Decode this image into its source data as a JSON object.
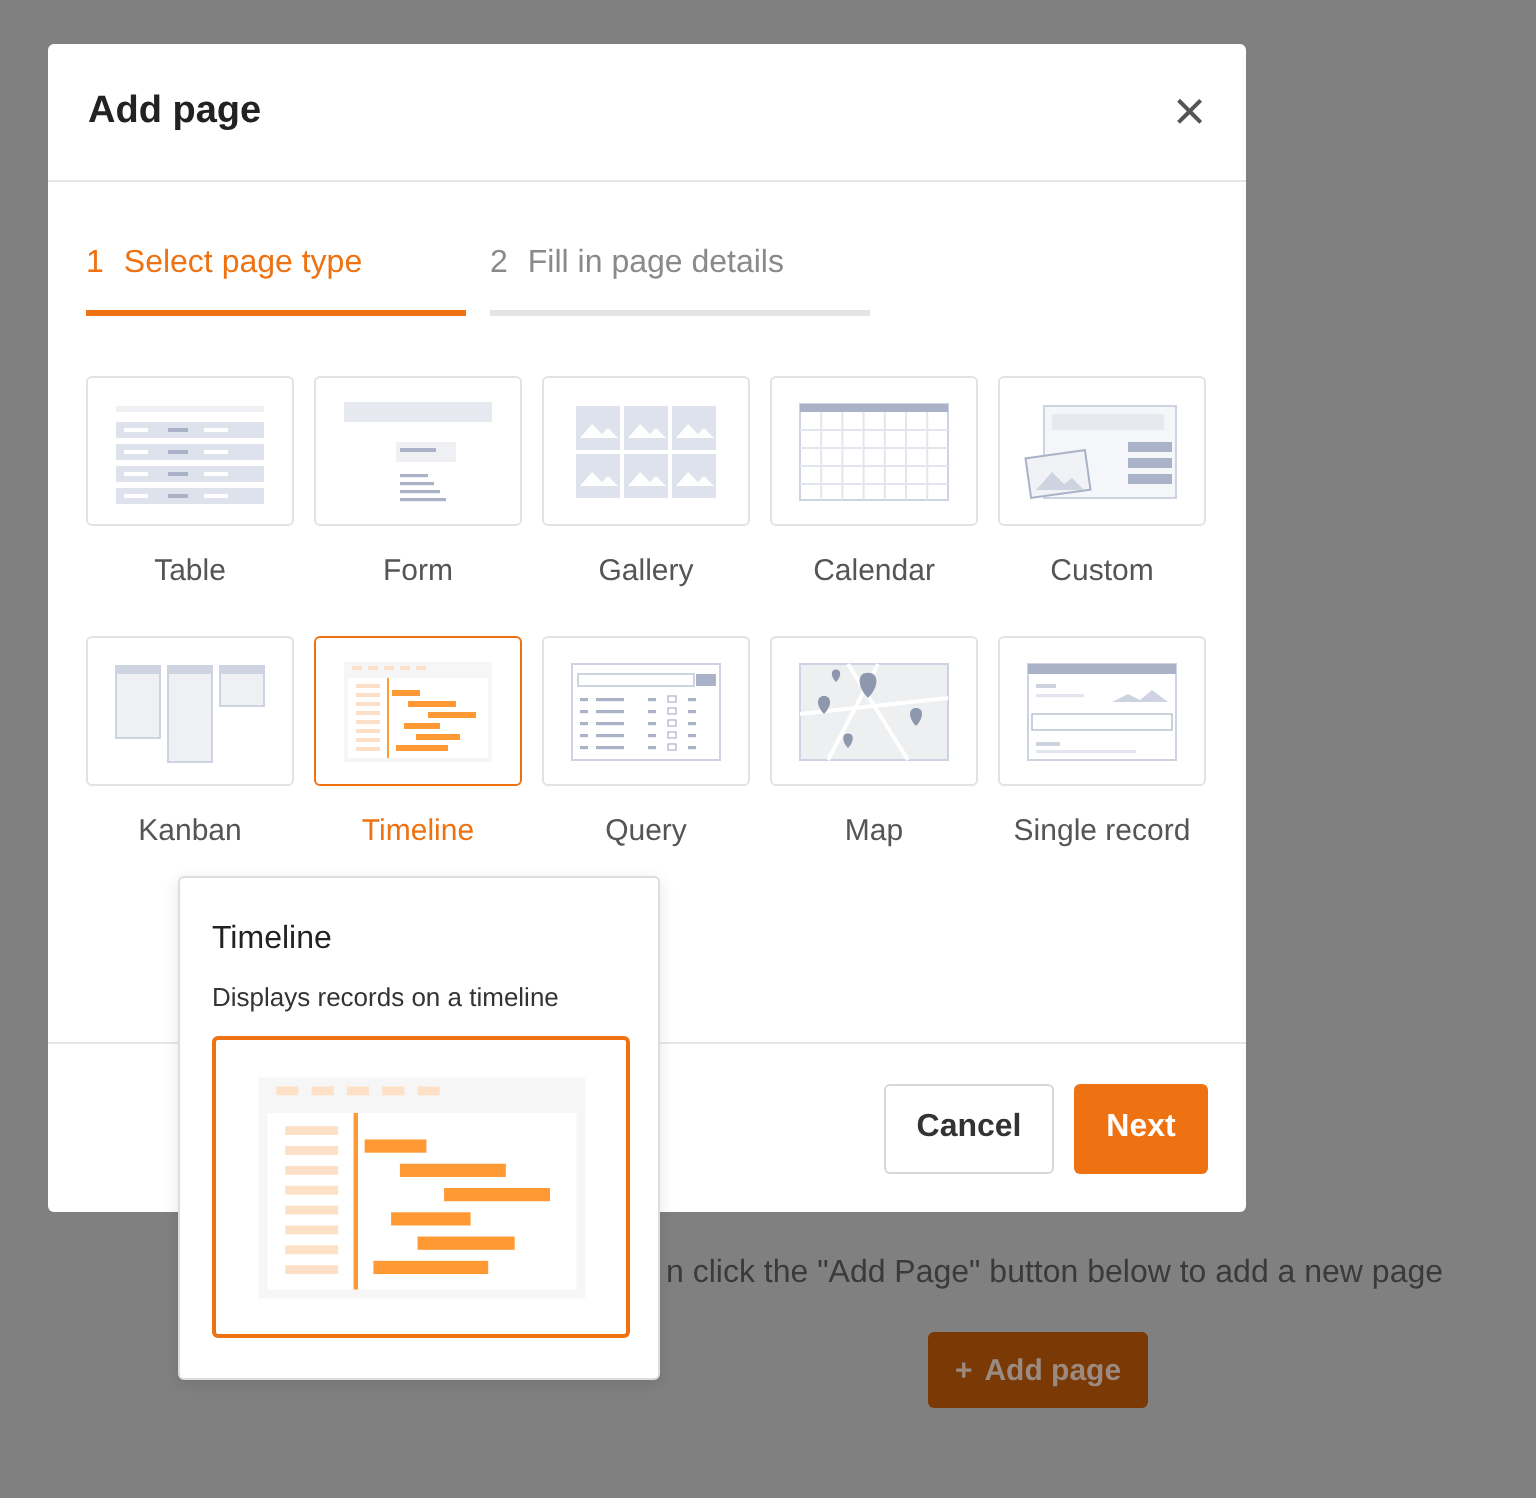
{
  "background_page": {
    "hint": "n click the \"Add Page\" button below to add a new page",
    "button": {
      "icon": "+",
      "label": "Add page"
    }
  },
  "dialog": {
    "title": "Add page",
    "close": "×",
    "steps": [
      {
        "number": "1",
        "label": "Select page type",
        "selected": true
      },
      {
        "number": "2",
        "label": "Fill in page details",
        "selected": false
      }
    ],
    "page_types": [
      {
        "kind": "table",
        "label": "Table",
        "selected": false
      },
      {
        "kind": "form",
        "label": "Form",
        "selected": false
      },
      {
        "kind": "gallery",
        "label": "Gallery",
        "selected": false
      },
      {
        "kind": "calendar",
        "label": "Calendar",
        "selected": false
      },
      {
        "kind": "custom",
        "label": "Custom",
        "selected": false
      },
      {
        "kind": "kanban",
        "label": "Kanban",
        "selected": false
      },
      {
        "kind": "timeline",
        "label": "Timeline",
        "selected": true
      },
      {
        "kind": "query",
        "label": "Query",
        "selected": false
      },
      {
        "kind": "map",
        "label": "Map",
        "selected": false
      },
      {
        "kind": "single",
        "label": "Single record",
        "selected": false
      }
    ],
    "buttons": [
      {
        "kind": "secondary",
        "label": "Cancel"
      },
      {
        "kind": "primary",
        "label": "Next"
      }
    ]
  },
  "popover": {
    "title": "Timeline",
    "description": "Displays records on a timeline",
    "preview": {
      "kind": "timeline"
    }
  }
}
